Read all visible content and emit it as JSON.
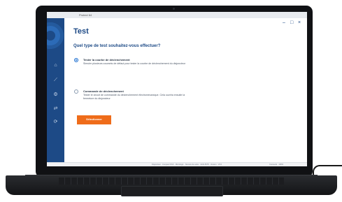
{
  "app": {
    "window_title": "Protect 64",
    "page_title": "Test",
    "question": "Quel type de test souhaitez-vous effectuer?"
  },
  "options": [
    {
      "title": "Tester la courbe de déclenchement",
      "description": "Simuler plusieurs courants de défaut pour tester la courbe de déclenchement du disjoncteur",
      "selected": true
    },
    {
      "title": "Commande de déclenchement",
      "description": "Tester le circuit de commande du déclenchement électromécanique. Cela ouvrira ensuite la fermeture du disjoncteur",
      "selected": false
    }
  ],
  "actions": {
    "select_label": "Sélectionner"
  },
  "window_controls": {
    "minimize": "–",
    "maximize": "□",
    "close": "×"
  },
  "sidebar_icons": [
    "home-icon",
    "curve-icon",
    "settings-icon",
    "link-icon",
    "share-icon"
  ],
  "statusbar": {
    "left": "Disjoncteur : Compact NSX · Micrologic · Numéro de série : 1234-5678 · Version : V2.0",
    "right": "Connecté · 100%"
  },
  "colors": {
    "brand": "#1d4a86",
    "accent": "#ef6c1a",
    "radio_selected": "#1d6fd1"
  }
}
